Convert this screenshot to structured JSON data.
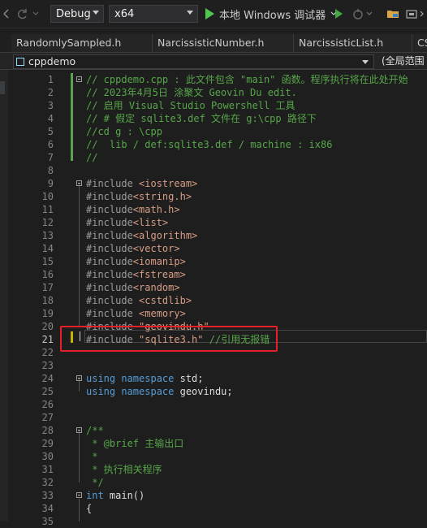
{
  "toolbar": {
    "configuration": "Debug",
    "platform": "x64",
    "run_label": "本地 Windows 调试器"
  },
  "tabs": [
    {
      "label": "RandomlySampled.h"
    },
    {
      "label": "NarcissisticNumber.h"
    },
    {
      "label": "NarcissisticList.h"
    },
    {
      "label": "CS"
    }
  ],
  "navbar": {
    "file": "cppdemo",
    "scope": "(全局范围"
  },
  "editor": {
    "lines": [
      {
        "n": "1",
        "segs": [
          {
            "c": "cm",
            "t": "// cppdemo.cpp : 此文件包含 \"main\" 函数。程序执行将在此处开始"
          }
        ]
      },
      {
        "n": "2",
        "segs": [
          {
            "c": "cm",
            "t": "// 2023年4月5日 涂聚文 Geovin Du edit."
          }
        ]
      },
      {
        "n": "3",
        "segs": [
          {
            "c": "cm",
            "t": "// 启用 Visual Studio Powershell 工具"
          }
        ]
      },
      {
        "n": "4",
        "segs": [
          {
            "c": "cm",
            "t": "// # 假定 sqlite3.def 文件在 g:\\cpp 路径下"
          }
        ]
      },
      {
        "n": "5",
        "segs": [
          {
            "c": "cm",
            "t": "//cd g : \\cpp"
          }
        ]
      },
      {
        "n": "6",
        "segs": [
          {
            "c": "cm",
            "t": "//  lib / def:sqlite3.def / machine : ix86"
          }
        ]
      },
      {
        "n": "7",
        "segs": [
          {
            "c": "cm",
            "t": "//"
          }
        ]
      },
      {
        "n": "8",
        "segs": []
      },
      {
        "n": "9",
        "segs": [
          {
            "c": "pp",
            "t": "#include "
          },
          {
            "c": "str",
            "t": "<iostream>"
          }
        ]
      },
      {
        "n": "10",
        "segs": [
          {
            "c": "pp",
            "t": "#include"
          },
          {
            "c": "str",
            "t": "<string.h>"
          }
        ]
      },
      {
        "n": "11",
        "segs": [
          {
            "c": "pp",
            "t": "#include"
          },
          {
            "c": "str",
            "t": "<math.h>"
          }
        ]
      },
      {
        "n": "12",
        "segs": [
          {
            "c": "pp",
            "t": "#include"
          },
          {
            "c": "str",
            "t": "<list>"
          }
        ]
      },
      {
        "n": "13",
        "segs": [
          {
            "c": "pp",
            "t": "#include"
          },
          {
            "c": "str",
            "t": "<algorithm>"
          }
        ]
      },
      {
        "n": "14",
        "segs": [
          {
            "c": "pp",
            "t": "#include"
          },
          {
            "c": "str",
            "t": "<vector>"
          }
        ]
      },
      {
        "n": "15",
        "segs": [
          {
            "c": "pp",
            "t": "#include"
          },
          {
            "c": "str",
            "t": "<iomanip>"
          }
        ]
      },
      {
        "n": "16",
        "segs": [
          {
            "c": "pp",
            "t": "#include"
          },
          {
            "c": "str",
            "t": "<fstream>"
          }
        ]
      },
      {
        "n": "17",
        "segs": [
          {
            "c": "pp",
            "t": "#include"
          },
          {
            "c": "str",
            "t": "<random>"
          }
        ]
      },
      {
        "n": "18",
        "segs": [
          {
            "c": "pp",
            "t": "#include "
          },
          {
            "c": "str",
            "t": "<cstdlib>"
          }
        ]
      },
      {
        "n": "19",
        "segs": [
          {
            "c": "pp",
            "t": "#include "
          },
          {
            "c": "str",
            "t": "<memory>"
          }
        ]
      },
      {
        "n": "20",
        "segs": [
          {
            "c": "pp",
            "t": "#include "
          },
          {
            "c": "str",
            "t": "\"geovindu.h\""
          }
        ]
      },
      {
        "n": "21",
        "segs": [
          {
            "c": "pp",
            "t": "#include "
          },
          {
            "c": "str",
            "t": "\"sqlite3.h\""
          },
          {
            "c": "id",
            "t": " "
          },
          {
            "c": "cm",
            "t": "//引用无报错"
          }
        ]
      },
      {
        "n": "22",
        "segs": []
      },
      {
        "n": "23",
        "segs": []
      },
      {
        "n": "24",
        "segs": [
          {
            "c": "kw",
            "t": "using namespace"
          },
          {
            "c": "id",
            "t": " std;"
          }
        ]
      },
      {
        "n": "25",
        "segs": [
          {
            "c": "kw",
            "t": "using namespace"
          },
          {
            "c": "id",
            "t": " geovindu;"
          }
        ]
      },
      {
        "n": "26",
        "segs": []
      },
      {
        "n": "27",
        "segs": []
      },
      {
        "n": "28",
        "segs": [
          {
            "c": "cm",
            "t": "/**"
          }
        ]
      },
      {
        "n": "29",
        "segs": [
          {
            "c": "cm",
            "t": " * @brief 主输出口"
          }
        ]
      },
      {
        "n": "30",
        "segs": [
          {
            "c": "cm",
            "t": " *"
          }
        ]
      },
      {
        "n": "31",
        "segs": [
          {
            "c": "cm",
            "t": " * 执行相关程序"
          }
        ]
      },
      {
        "n": "32",
        "segs": [
          {
            "c": "cm",
            "t": " */"
          }
        ]
      },
      {
        "n": "33",
        "segs": [
          {
            "c": "kw",
            "t": "int"
          },
          {
            "c": "id",
            "t": " main()"
          }
        ]
      },
      {
        "n": "34",
        "segs": [
          {
            "c": "id",
            "t": "{"
          }
        ]
      },
      {
        "n": "35",
        "segs": []
      }
    ]
  }
}
